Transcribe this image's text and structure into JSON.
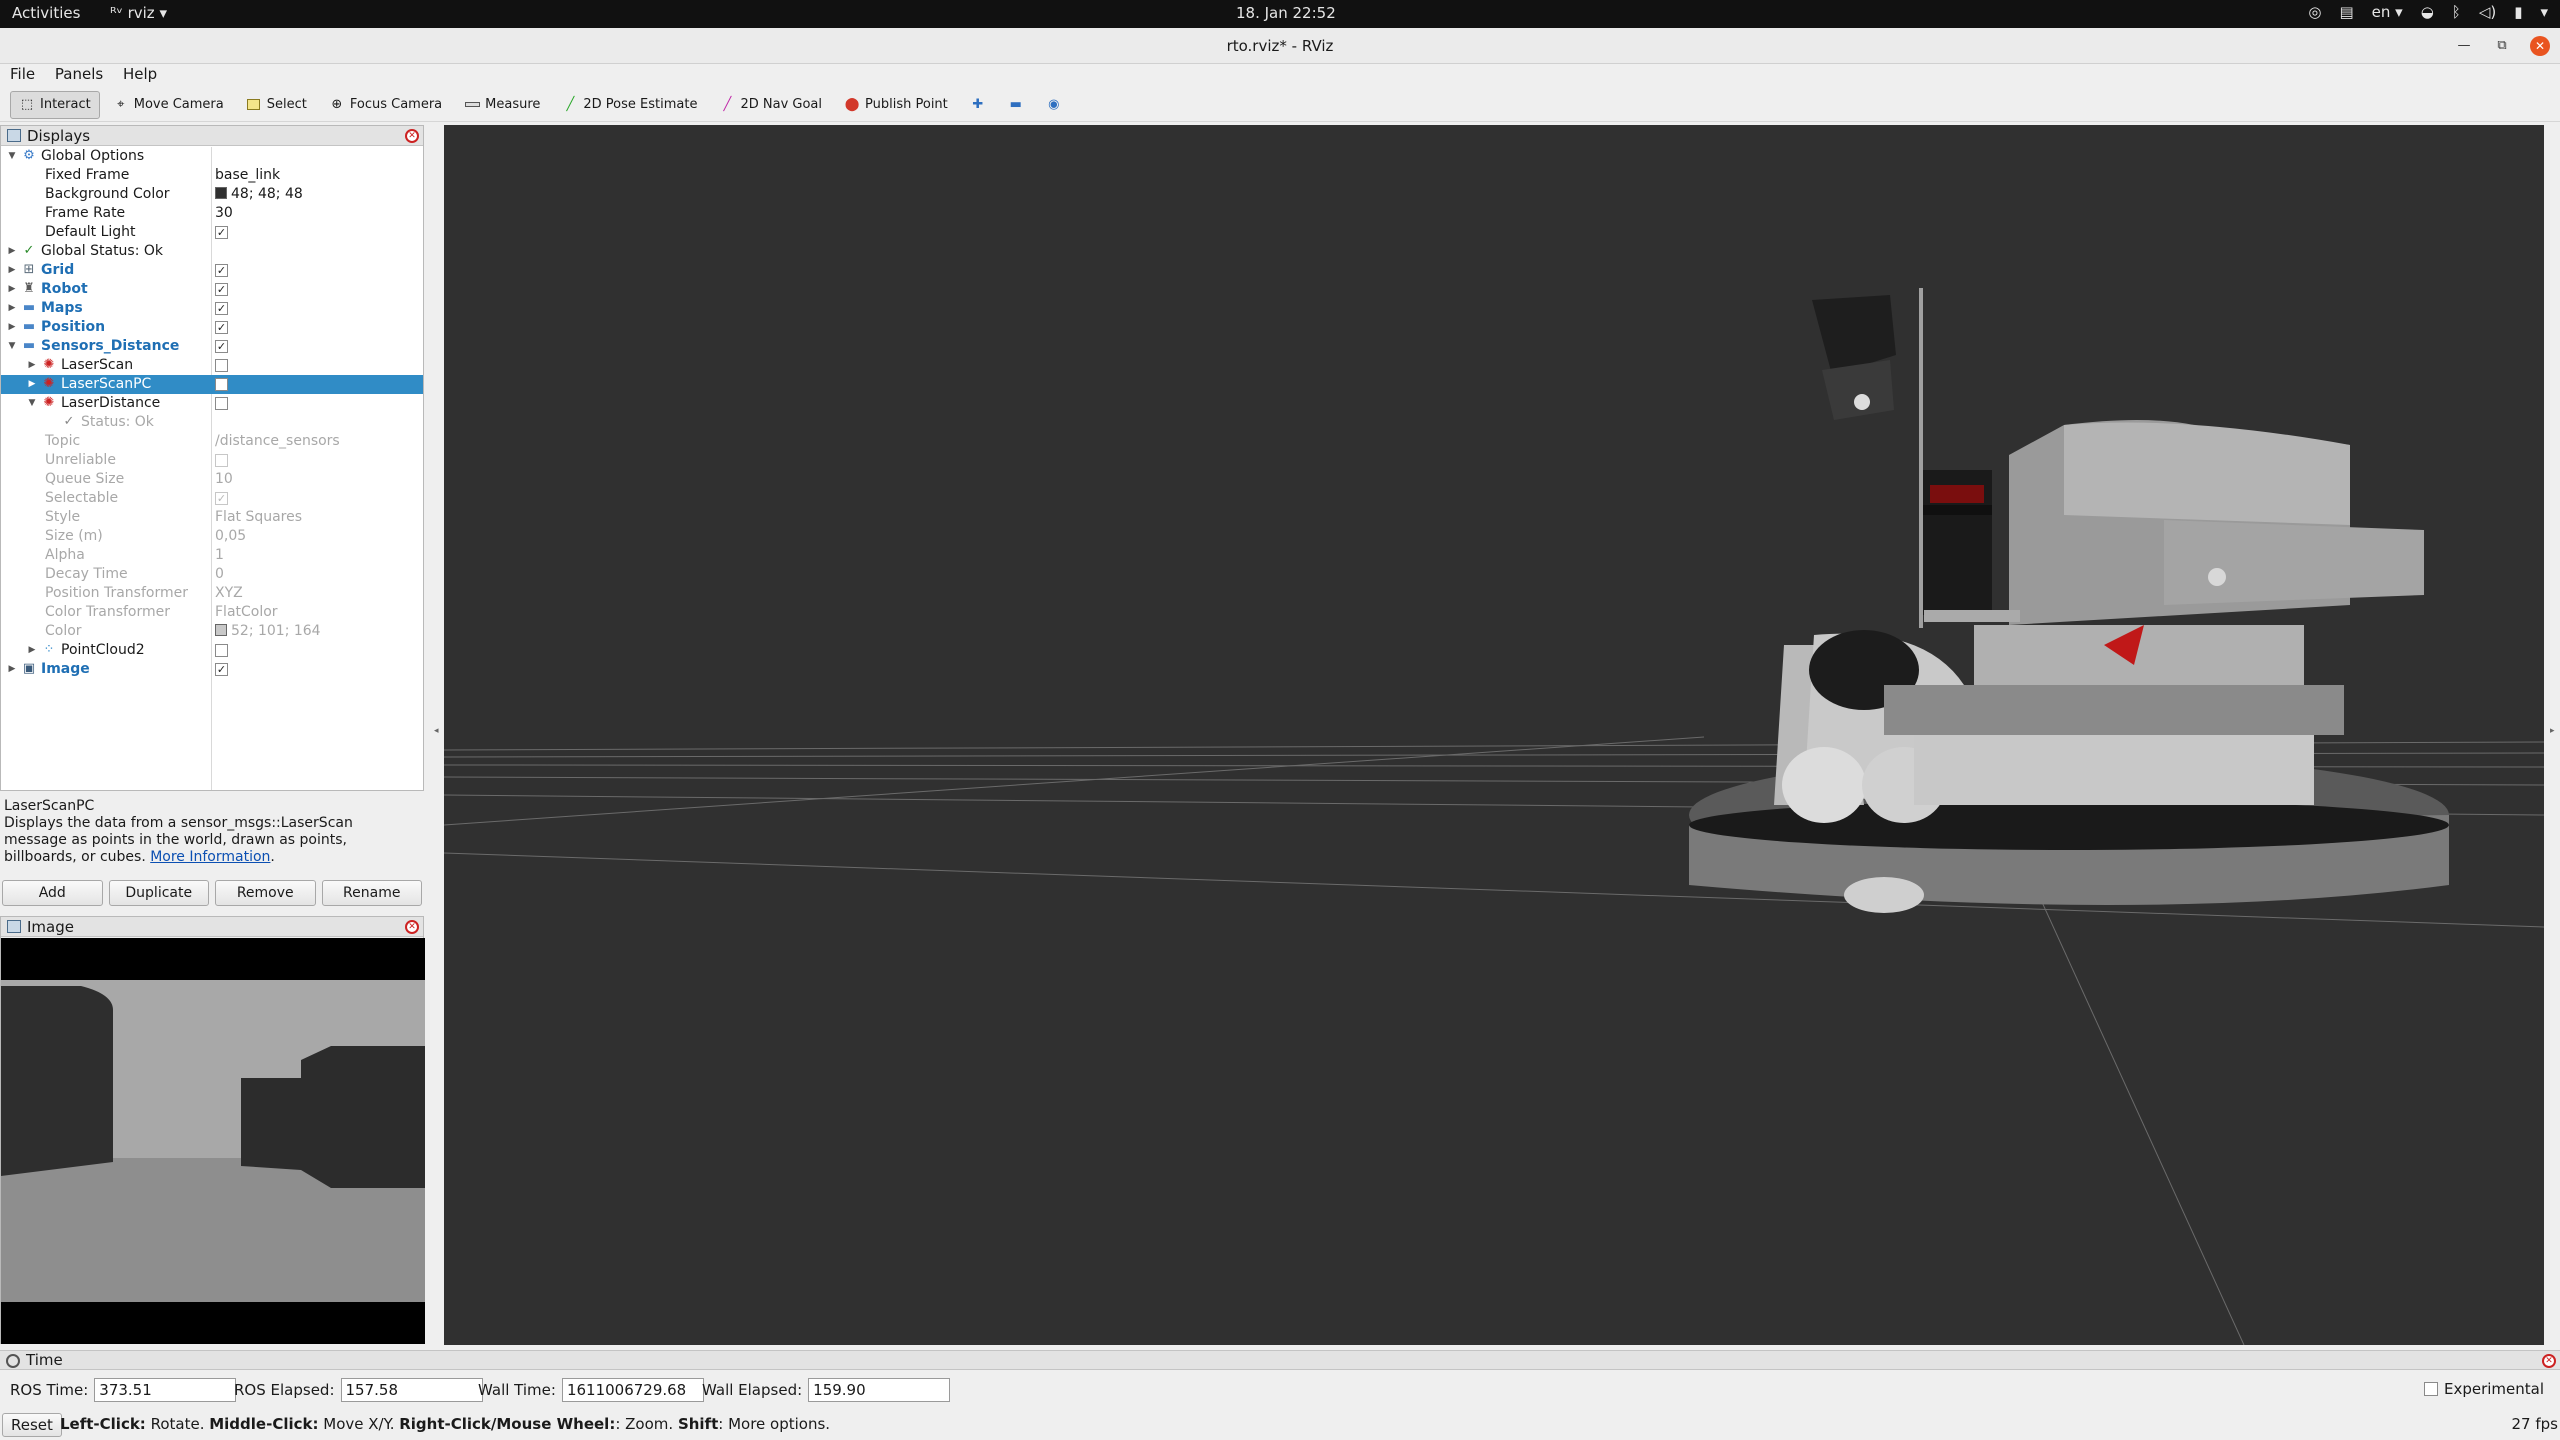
{
  "topbar": {
    "activities": "Activities",
    "app": "rviz",
    "clock": "18. Jan  22:52",
    "lang": "en"
  },
  "window": {
    "title": "rto.rviz* - RViz"
  },
  "menubar": {
    "items": [
      "File",
      "Panels",
      "Help"
    ]
  },
  "toolbar": {
    "tools": [
      {
        "label": "Interact",
        "icon": "interact-icon",
        "active": true
      },
      {
        "label": "Move Camera",
        "icon": "move-camera-icon"
      },
      {
        "label": "Select",
        "icon": "select-icon"
      },
      {
        "label": "Focus Camera",
        "icon": "focus-camera-icon"
      },
      {
        "label": "Measure",
        "icon": "measure-icon"
      },
      {
        "label": "2D Pose Estimate",
        "icon": "pose-estimate-icon"
      },
      {
        "label": "2D Nav Goal",
        "icon": "nav-goal-icon"
      },
      {
        "label": "Publish Point",
        "icon": "publish-point-icon"
      }
    ]
  },
  "displays": {
    "title": "Displays",
    "rows": [
      {
        "label": "Global Options",
        "indent": 0,
        "arrow": "open",
        "icon": "gear-icon"
      },
      {
        "label": "Fixed Frame",
        "indent": 1,
        "value": "base_link"
      },
      {
        "label": "Background Color",
        "indent": 1,
        "value": "48; 48; 48",
        "swatch": "#303030"
      },
      {
        "label": "Frame Rate",
        "indent": 1,
        "value": "30"
      },
      {
        "label": "Default Light",
        "indent": 1,
        "check": true
      },
      {
        "label": "Global Status: Ok",
        "indent": 0,
        "arrow": "closed",
        "icon": "check-icon"
      },
      {
        "label": "Grid",
        "indent": 0,
        "arrow": "closed",
        "icon": "grid-icon",
        "check": true,
        "bold": true
      },
      {
        "label": "Robot",
        "indent": 0,
        "arrow": "closed",
        "icon": "robot-icon",
        "check": true,
        "bold": true
      },
      {
        "label": "Maps",
        "indent": 0,
        "arrow": "closed",
        "icon": "folder-icon",
        "check": true,
        "bold": true
      },
      {
        "label": "Position",
        "indent": 0,
        "arrow": "closed",
        "icon": "folder-icon",
        "check": true,
        "bold": true
      },
      {
        "label": "Sensors_Distance",
        "indent": 0,
        "arrow": "open",
        "icon": "folder-icon",
        "check": true,
        "bold": true
      },
      {
        "label": "LaserScan",
        "indent": 1,
        "arrow": "closed",
        "icon": "laserscan-icon",
        "check": false
      },
      {
        "label": "LaserScanPC",
        "indent": 1,
        "arrow": "closed",
        "icon": "laserscan-icon",
        "check": false,
        "selected": true
      },
      {
        "label": "LaserDistance",
        "indent": 1,
        "arrow": "open",
        "icon": "laserscan-icon",
        "check": false
      },
      {
        "label": "Status: Ok",
        "indent": 2,
        "icon": "check-icon",
        "dim": true
      },
      {
        "label": "Topic",
        "indent": 2,
        "value": "/distance_sensors",
        "dim": true
      },
      {
        "label": "Unreliable",
        "indent": 2,
        "check": false,
        "dim": true
      },
      {
        "label": "Queue Size",
        "indent": 2,
        "value": "10",
        "dim": true
      },
      {
        "label": "Selectable",
        "indent": 2,
        "check": true,
        "dim": true
      },
      {
        "label": "Style",
        "indent": 2,
        "value": "Flat Squares",
        "dim": true
      },
      {
        "label": "Size (m)",
        "indent": 2,
        "value": "0,05",
        "dim": true
      },
      {
        "label": "Alpha",
        "indent": 2,
        "value": "1",
        "dim": true
      },
      {
        "label": "Decay Time",
        "indent": 2,
        "value": "0",
        "dim": true
      },
      {
        "label": "Position Transformer",
        "indent": 2,
        "value": "XYZ",
        "dim": true
      },
      {
        "label": "Color Transformer",
        "indent": 2,
        "value": "FlatColor",
        "dim": true
      },
      {
        "label": "Color",
        "indent": 2,
        "value": "52; 101; 164",
        "swatch": "#c8c8c8",
        "dim": true
      },
      {
        "label": "PointCloud2",
        "indent": 1,
        "arrow": "closed",
        "icon": "pointcloud-icon",
        "check": false
      },
      {
        "label": "Image",
        "indent": 0,
        "arrow": "closed",
        "icon": "image-icon",
        "check": true,
        "bold": true
      }
    ]
  },
  "description": {
    "title": "LaserScanPC",
    "text": "Displays the data from a sensor_msgs::LaserScan message as points in the world, drawn as points, billboards, or cubes.",
    "link": "More Information",
    "link_suffix": "."
  },
  "display_buttons": [
    "Add",
    "Duplicate",
    "Remove",
    "Rename"
  ],
  "image_panel": {
    "title": "Image"
  },
  "time_panel": {
    "title": "Time",
    "ros_time_label": "ROS Time:",
    "ros_time": "373.51",
    "ros_elapsed_label": "ROS Elapsed:",
    "ros_elapsed": "157.58",
    "wall_time_label": "Wall Time:",
    "wall_time": "1611006729.68",
    "wall_elapsed_label": "Wall Elapsed:",
    "wall_elapsed": "159.90",
    "experimental_label": "Experimental"
  },
  "statusbar": {
    "reset": "Reset",
    "hint_left_key": "Left-Click:",
    "hint_left": " Rotate. ",
    "hint_middle_key": "Middle-Click:",
    "hint_middle": " Move X/Y. ",
    "hint_right_key": "Right-Click/Mouse Wheel:",
    "hint_right": ": Zoom. ",
    "hint_shift_key": "Shift",
    "hint_shift": ": More options.",
    "fps": "27 fps"
  },
  "colors": {
    "background": "#303030",
    "selection": "#308cc6",
    "display_group": "#1f6fb4"
  }
}
